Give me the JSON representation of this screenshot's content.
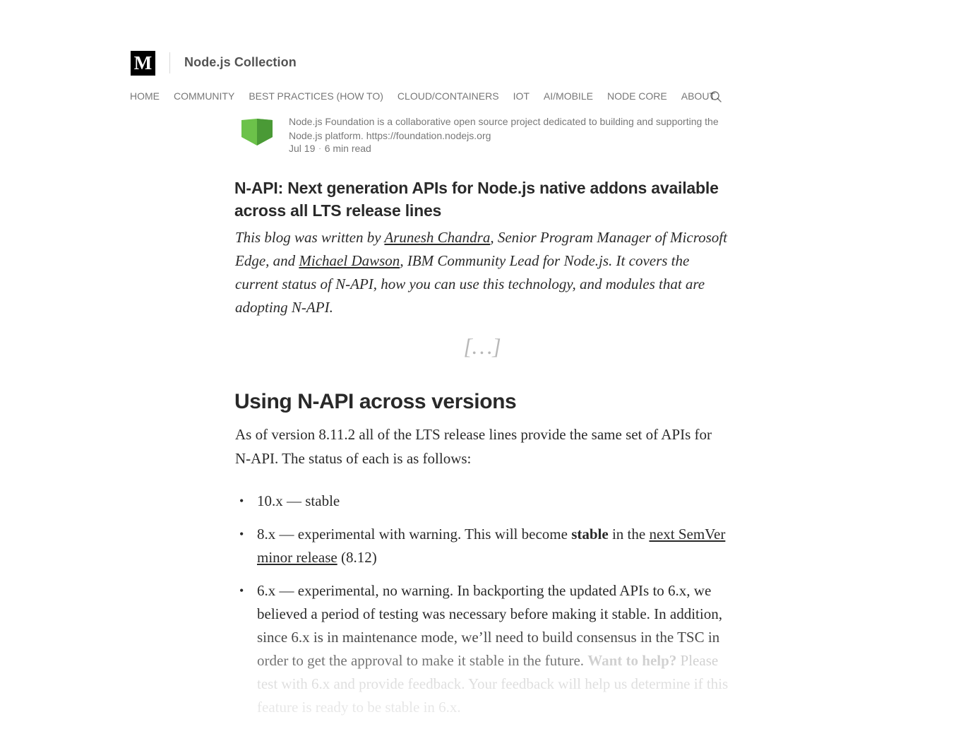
{
  "header": {
    "logo_letter": "M",
    "publication": "Node.js Collection",
    "nav": [
      "HOME",
      "COMMUNITY",
      "BEST PRACTICES (HOW TO)",
      "CLOUD/CONTAINERS",
      "IOT",
      "AI/MOBILE",
      "NODE CORE",
      "ABOUT"
    ],
    "search_icon": "search-icon"
  },
  "author": {
    "bio": "Node.js Foundation is a collaborative open source project dedicated to building and supporting the Node.js platform. https://foundation.nodejs.org",
    "date": "Jul 19",
    "read_time": "6 min read",
    "avatar_color": "#5aa844"
  },
  "article": {
    "title": "N-API: Next generation APIs for Node.js native addons available across all LTS release lines",
    "intro": {
      "prefix": "This blog was written by ",
      "author1": "Arunesh Chandra",
      "middle": ", Senior Program Manager of Microsoft Edge, and ",
      "author2": "Michael Dawson",
      "suffix": ", IBM Community Lead for Node.js. It covers the current status of N-API, how you can use this technology, and modules that are adopting N-API."
    },
    "ellipsis": "[…]",
    "section_heading": "Using N-API across versions",
    "paragraph": "As of version 8.11.2 all of the LTS release lines provide the same set of APIs for N-API. The status of each is as follows:",
    "list": {
      "item1": "10.x — stable",
      "item2_prefix": "8.x — experimental with warning. This will become ",
      "item2_bold": "stable",
      "item2_mid": " in the ",
      "item2_link": "next SemVer minor release",
      "item2_suffix": " (8.12)",
      "item3_text": "6.x — experimental, no warning. In backporting the updated APIs to 6.x, we believed a period of testing was necessary before making it stable. In addition, since 6.x is in maintenance mode, we’ll need to build consensus in the TSC in order to get the approval to make it stable in the future.",
      "item3_bold": "Want to help?",
      "item3_faded": " Please test with 6.x and provide feedback. Your feedback will help us determine if this feature is ready to be stable in 6.x."
    }
  }
}
